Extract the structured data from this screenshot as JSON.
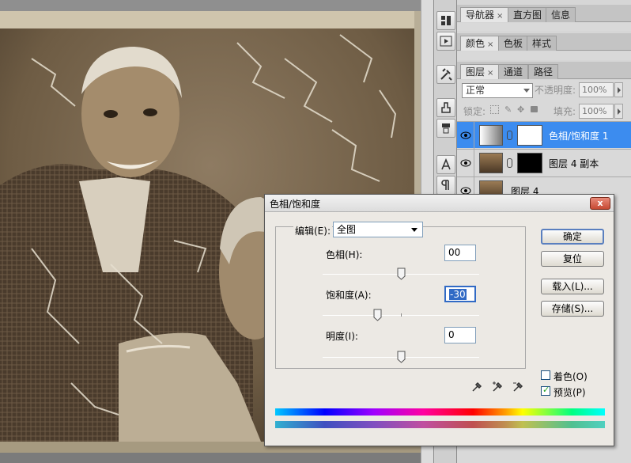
{
  "panels": {
    "top_tabs": [
      {
        "label": "导航器",
        "close": "×"
      },
      {
        "label": "直方图"
      },
      {
        "label": "信息"
      }
    ],
    "color_tabs": [
      {
        "label": "颜色",
        "close": "×"
      },
      {
        "label": "色板"
      },
      {
        "label": "样式"
      }
    ],
    "layer_tabs": [
      {
        "label": "图层",
        "close": "×"
      },
      {
        "label": "通道"
      },
      {
        "label": "路径"
      }
    ],
    "layers": {
      "blend_mode": "正常",
      "opacity_label": "不透明度:",
      "opacity_value": "100%",
      "lock_label": "锁定:",
      "fill_label": "填充:",
      "fill_value": "100%",
      "items": [
        {
          "name": "色相/饱和度 1",
          "selected": true
        },
        {
          "name": "图层 4 副本",
          "selected": false
        },
        {
          "name": "图层 4",
          "selected": false
        }
      ]
    }
  },
  "dialog": {
    "title": "色相/饱和度",
    "close": "x",
    "edit_label": "编辑(E):",
    "edit_value": "全图",
    "hue_label": "色相(H):",
    "hue_value": "00",
    "hue_slider": 0.5,
    "saturation_label": "饱和度(A):",
    "saturation_value": "-30",
    "saturation_slider": 0.35,
    "lightness_label": "明度(I):",
    "lightness_value": "0",
    "lightness_slider": 0.5,
    "buttons": {
      "ok": "确定",
      "reset": "复位",
      "load": "载入(L)...",
      "save": "存储(S)..."
    },
    "colorize_label": "着色(O)",
    "colorize_checked": false,
    "preview_label": "预览(P)",
    "preview_checked": true
  },
  "colors": {
    "selection_blue": "#3c8cef",
    "dialog_bg": "#ece9e4"
  }
}
